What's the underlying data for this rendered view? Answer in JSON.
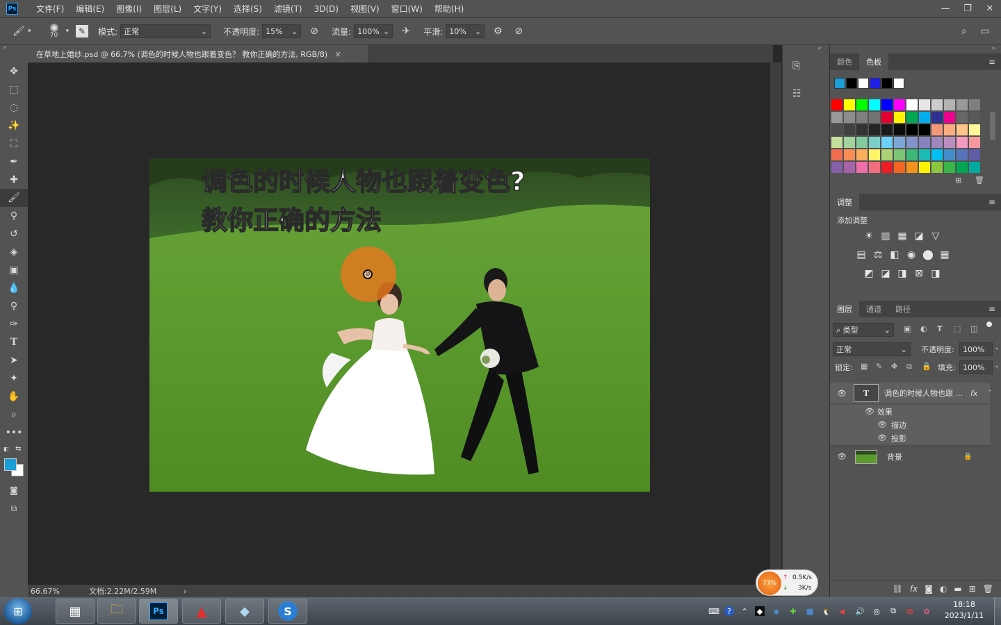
{
  "menubar": {
    "logo": "Ps",
    "items": [
      "文件(F)",
      "编辑(E)",
      "图像(I)",
      "图层(L)",
      "文字(Y)",
      "选择(S)",
      "滤镜(T)",
      "3D(D)",
      "视图(V)",
      "窗口(W)",
      "帮助(H)"
    ],
    "window_controls": [
      "—",
      "❐",
      "✕"
    ]
  },
  "options": {
    "brush_size": "70",
    "mode_label": "模式:",
    "mode_value": "正常",
    "opacity_label": "不透明度:",
    "opacity_value": "15%",
    "flow_label": "流量:",
    "flow_value": "100%",
    "smooth_label": "平滑:",
    "smooth_value": "10%"
  },
  "document": {
    "tab_title": "在草地上婚纱.psd @ 66.7% (调色的时候人物也跟着变色？ 教你正确的方法, RGB/8)",
    "close": "×",
    "headline_line1": "调色的时候人物也跟着变色?",
    "headline_line2": "教你正确的方法"
  },
  "status": {
    "zoom": "66.67%",
    "doc_size": "文档:2.22M/2.59M",
    "arrow": "›"
  },
  "swatches_panel": {
    "tabs": [
      "颜色",
      "色板"
    ],
    "active_tab": 1,
    "recent": [
      "#1a9ed8",
      "#000000",
      "#ffffff",
      "#1e1ee6",
      "#000000",
      "#ffffff"
    ],
    "grid": [
      [
        "#ff0000",
        "#ffff00",
        "#00ff00",
        "#00ffff",
        "#0000ff",
        "#ff00ff",
        "#ffffff",
        "#e6e6e6",
        "#cccccc",
        "#b3b3b3",
        "#999999",
        "#808080"
      ],
      [
        "#999999",
        "#8c8c8c",
        "#7f7f7f",
        "#737373",
        "#e6002e",
        "#fff200",
        "#00a650",
        "#00aeef",
        "#2e3192",
        "#ec008c",
        "#666666",
        "#595959"
      ],
      [
        "#4d4d4d",
        "#404040",
        "#333333",
        "#262626",
        "#1a1a1a",
        "#0d0d0d",
        "#000000",
        "#000000",
        "#f7977a",
        "#f9ad81",
        "#fdc689",
        "#fff79a"
      ],
      [
        "#c4df9b",
        "#a3d39c",
        "#82ca9d",
        "#7bcdc8",
        "#6ecff6",
        "#7ea7d8",
        "#8493ca",
        "#8882be",
        "#a187be",
        "#bc8dbf",
        "#f49ac2",
        "#f6989d"
      ],
      [
        "#f26c4f",
        "#f68e56",
        "#fbaf5d",
        "#fff568",
        "#acd373",
        "#7cc576",
        "#3bb878",
        "#1abbb4",
        "#00bff3",
        "#448ccb",
        "#5574b9",
        "#605ca8"
      ],
      [
        "#855fa8",
        "#a763a8",
        "#f06eaa",
        "#f26d7d",
        "#ed1c24",
        "#f26522",
        "#f7941d",
        "#fff200",
        "#8dc63f",
        "#39b54a",
        "#00a651",
        "#00a99d"
      ]
    ]
  },
  "adjustments_panel": {
    "tab": "调整",
    "add_label": "添加调整",
    "row1": [
      "☀",
      "▥",
      "▦",
      "◪",
      "▽"
    ],
    "row2": [
      "▤",
      "⚖",
      "◧",
      "◉",
      "⬤",
      "▦"
    ],
    "row3": [
      "◩",
      "◪",
      "◨",
      "⊠",
      "◨"
    ]
  },
  "layers_panel": {
    "tabs": [
      "图层",
      "通道",
      "路径"
    ],
    "active_tab": 0,
    "filter_value": "类型",
    "blend_value": "正常",
    "opacity_label": "不透明度:",
    "opacity_value": "100%",
    "lock_label": "锁定:",
    "fill_label": "填充:",
    "fill_value": "100%",
    "text_layer_name": "调色的时候人物也跟 ...",
    "effects_label": "效果",
    "effect1": "描边",
    "effect2": "投影",
    "bg_layer_name": "背景",
    "fx": "fx"
  },
  "network_widget": {
    "percent": "77%",
    "up": "0.5K/s",
    "down": "3K/s"
  },
  "taskbar": {
    "time": "18:18",
    "date": "2023/1/11"
  }
}
